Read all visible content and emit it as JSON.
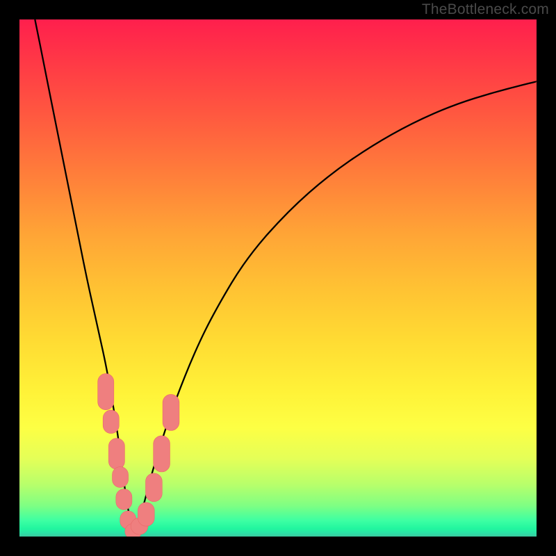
{
  "watermark": "TheBottleneck.com",
  "palette": {
    "curve": "#000000",
    "marker_fill": "#ef7f7f",
    "marker_stroke": "#e96a6a",
    "frame": "#000000"
  },
  "chart_data": {
    "type": "line",
    "title": "",
    "xlabel": "",
    "ylabel": "",
    "xlim": [
      0,
      100
    ],
    "ylim": [
      0,
      100
    ],
    "grid": false,
    "legend": false,
    "minimum_x": 22,
    "series": [
      {
        "name": "bottleneck-curve",
        "x": [
          3,
          5,
          7,
          9,
          11,
          13,
          15,
          17,
          19,
          20,
          21,
          22,
          23,
          24,
          25,
          27,
          30,
          34,
          38,
          44,
          52,
          60,
          68,
          76,
          84,
          92,
          100
        ],
        "y": [
          100,
          90,
          80,
          70,
          60,
          50,
          41,
          32,
          20,
          12,
          5,
          1,
          3,
          6,
          10,
          17,
          26,
          36,
          44,
          54,
          63,
          70,
          75.5,
          80,
          83.5,
          86,
          88
        ]
      }
    ],
    "markers": [
      {
        "x": 16.7,
        "y": 28,
        "w": 3.1,
        "h": 7
      },
      {
        "x": 17.7,
        "y": 22.2,
        "w": 3.1,
        "h": 4.5
      },
      {
        "x": 18.8,
        "y": 16,
        "w": 3.1,
        "h": 6
      },
      {
        "x": 19.5,
        "y": 11.5,
        "w": 3.1,
        "h": 4
      },
      {
        "x": 20.2,
        "y": 7.2,
        "w": 3.1,
        "h": 4
      },
      {
        "x": 21.0,
        "y": 3.2,
        "w": 3.1,
        "h": 3.5
      },
      {
        "x": 22.0,
        "y": 1.0,
        "w": 3.2,
        "h": 3.0
      },
      {
        "x": 23.2,
        "y": 2.0,
        "w": 3.3,
        "h": 3.2
      },
      {
        "x": 24.5,
        "y": 4.3,
        "w": 3.2,
        "h": 4.6
      },
      {
        "x": 26.0,
        "y": 9.5,
        "w": 3.2,
        "h": 5.5
      },
      {
        "x": 27.5,
        "y": 16,
        "w": 3.2,
        "h": 7
      },
      {
        "x": 29.3,
        "y": 24,
        "w": 3.2,
        "h": 7
      }
    ]
  }
}
